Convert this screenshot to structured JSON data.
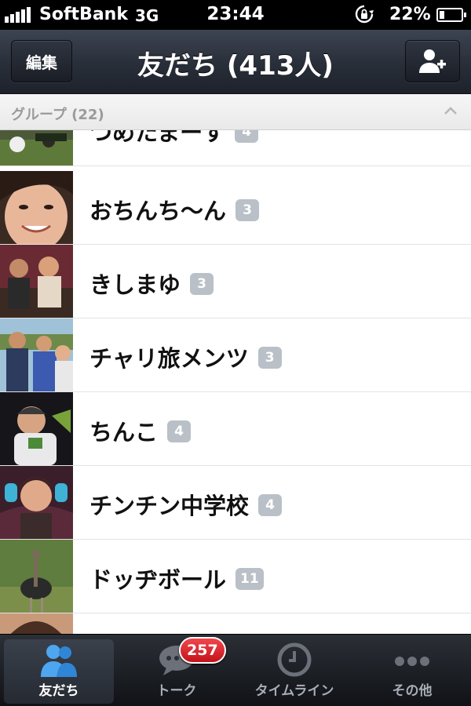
{
  "status_bar": {
    "carrier": "SoftBank",
    "network": "3G",
    "time": "23:44",
    "battery_percent": "22%",
    "battery_level": 0.22
  },
  "navbar": {
    "edit_label": "編集",
    "title": "友だち (413人)",
    "add_friend_icon": "add-person-icon"
  },
  "section": {
    "label": "グループ (22)",
    "icon": "chevron-up-icon"
  },
  "groups": [
    {
      "name": "つめたまーす",
      "count": "4"
    },
    {
      "name": "おちんち〜ん",
      "count": "3"
    },
    {
      "name": "きしまゆ",
      "count": "3"
    },
    {
      "name": "チャリ旅メンツ",
      "count": "3"
    },
    {
      "name": "ちんこ",
      "count": "4"
    },
    {
      "name": "チンチン中学校",
      "count": "4"
    },
    {
      "name": "ドッヂボール",
      "count": "11"
    }
  ],
  "tabbar": {
    "tabs": [
      {
        "label": "友だち",
        "icon": "friends-icon",
        "active": true
      },
      {
        "label": "トーク",
        "icon": "chat-bubble-icon",
        "active": false
      },
      {
        "label": "タイムライン",
        "icon": "clock-icon",
        "active": false
      },
      {
        "label": "その他",
        "icon": "more-dots-icon",
        "active": false
      }
    ],
    "talk_badge": "257"
  },
  "colors": {
    "navbar": "#2a303b",
    "badge": "#d9232b",
    "count_badge": "#b9c0c7",
    "section_bg": "#efefef"
  }
}
